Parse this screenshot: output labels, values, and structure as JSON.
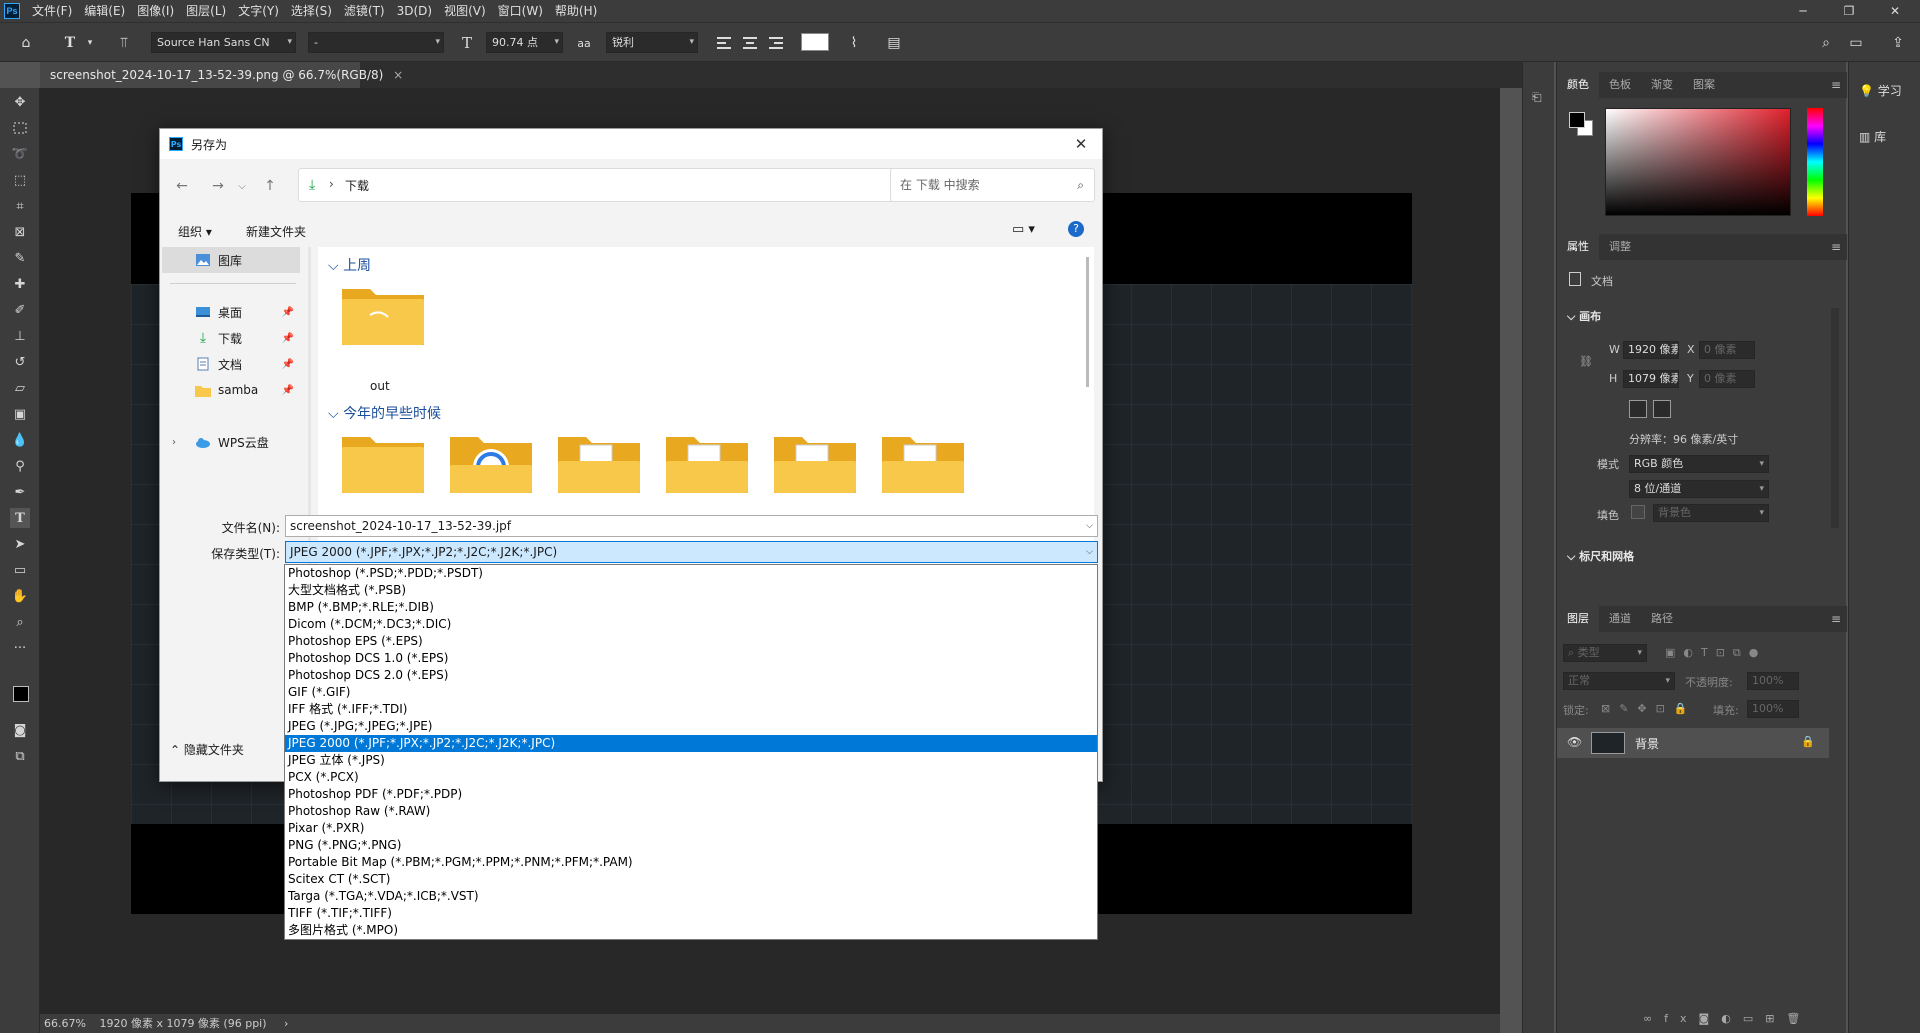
{
  "app": {
    "logo": "Ps",
    "menu": [
      "文件(F)",
      "编辑(E)",
      "图像(I)",
      "图层(L)",
      "文字(Y)",
      "选择(S)",
      "滤镜(T)",
      "3D(D)",
      "视图(V)",
      "窗口(W)",
      "帮助(H)"
    ]
  },
  "options_bar": {
    "font_family": "Source Han Sans CN",
    "font_style": "-",
    "font_size": "90.74 点",
    "antialias_icon_label": "aa",
    "antialias": "锐利"
  },
  "document": {
    "tab_title": "screenshot_2024-10-17_13-52-39.png @ 66.7%(RGB/8)",
    "status_zoom": "66.67%",
    "status_info": "1920 像素 x 1079 像素 (96 ppi)"
  },
  "panels": {
    "color_tabs": [
      "颜色",
      "色板",
      "渐变",
      "图案"
    ],
    "props_tabs": [
      "属性",
      "调整"
    ],
    "props_doc": "文档",
    "canvas_section": "画布",
    "w_label": "W",
    "w_value": "1920 像素",
    "x_label": "X",
    "x_placeholder": "0 像素",
    "h_label": "H",
    "h_value": "1079 像素",
    "y_label": "Y",
    "y_placeholder": "0 像素",
    "resolution": "分辨率：96 像素/英寸",
    "mode_label": "模式",
    "mode_value": "RGB 颜色",
    "depth_value": "8 位/通道",
    "fill_label": "填色",
    "fill_value": "背景色",
    "rulers_section": "标尺和网格",
    "layers_tabs": [
      "图层",
      "通道",
      "路径"
    ],
    "layer_filter": "类型",
    "blend_mode": "正常",
    "opacity_label": "不透明度:",
    "opacity_value": "100%",
    "lock_label": "锁定:",
    "fill2_label": "填充:",
    "fill2_value": "100%",
    "layer_name": "背景"
  },
  "dock_right": {
    "learn": "学习",
    "library": "库"
  },
  "dialog": {
    "logo": "Ps",
    "title": "另存为",
    "breadcrumb": "下载",
    "search_placeholder": "在 下载 中搜索",
    "organize": "组织 ▾",
    "new_folder": "新建文件夹",
    "nav_items": [
      {
        "label": "图库",
        "icon": "gallery-icon"
      },
      {
        "label": "桌面",
        "icon": "desktop-icon"
      },
      {
        "label": "下载",
        "icon": "download-icon"
      },
      {
        "label": "文档",
        "icon": "document-icon"
      },
      {
        "label": "samba",
        "icon": "folder-icon"
      },
      {
        "label": "WPS云盘",
        "icon": "cloud-icon"
      }
    ],
    "group_last_week": "上周",
    "folder_out": "out",
    "group_earlier": "今年的早些时候",
    "filename_label": "文件名(N):",
    "filename_value": "screenshot_2024-10-17_13-52-39.jpf",
    "filetype_label": "保存类型(T):",
    "filetype_value": "JPEG 2000 (*.JPF;*.JPX;*.JP2;*.J2C;*.J2K;*.JPC)",
    "hide_folders": "隐藏文件夹"
  },
  "filetype_options": [
    "Photoshop (*.PSD;*.PDD;*.PSDT)",
    "大型文档格式 (*.PSB)",
    "BMP (*.BMP;*.RLE;*.DIB)",
    "Dicom (*.DCM;*.DC3;*.DIC)",
    "Photoshop EPS (*.EPS)",
    "Photoshop DCS 1.0 (*.EPS)",
    "Photoshop DCS 2.0 (*.EPS)",
    "GIF (*.GIF)",
    "IFF 格式 (*.IFF;*.TDI)",
    "JPEG (*.JPG;*.JPEG;*.JPE)",
    "JPEG 2000 (*.JPF;*.JPX;*.JP2;*.J2C;*.J2K;*.JPC)",
    "JPEG 立体 (*.JPS)",
    "PCX (*.PCX)",
    "Photoshop PDF (*.PDF;*.PDP)",
    "Photoshop Raw (*.RAW)",
    "Pixar (*.PXR)",
    "PNG (*.PNG;*.PNG)",
    "Portable Bit Map (*.PBM;*.PGM;*.PPM;*.PNM;*.PFM;*.PAM)",
    "Scitex CT (*.SCT)",
    "Targa (*.TGA;*.VDA;*.ICB;*.VST)",
    "TIFF (*.TIF;*.TIFF)",
    "多图片格式 (*.MPO)"
  ],
  "selected_filetype_index": 10,
  "colors": {
    "ps_dark": "#3c3c3c",
    "accent_blue": "#0078d7",
    "folder_yellow": "#f8c84a",
    "color_picker_red": "#e0202c"
  }
}
